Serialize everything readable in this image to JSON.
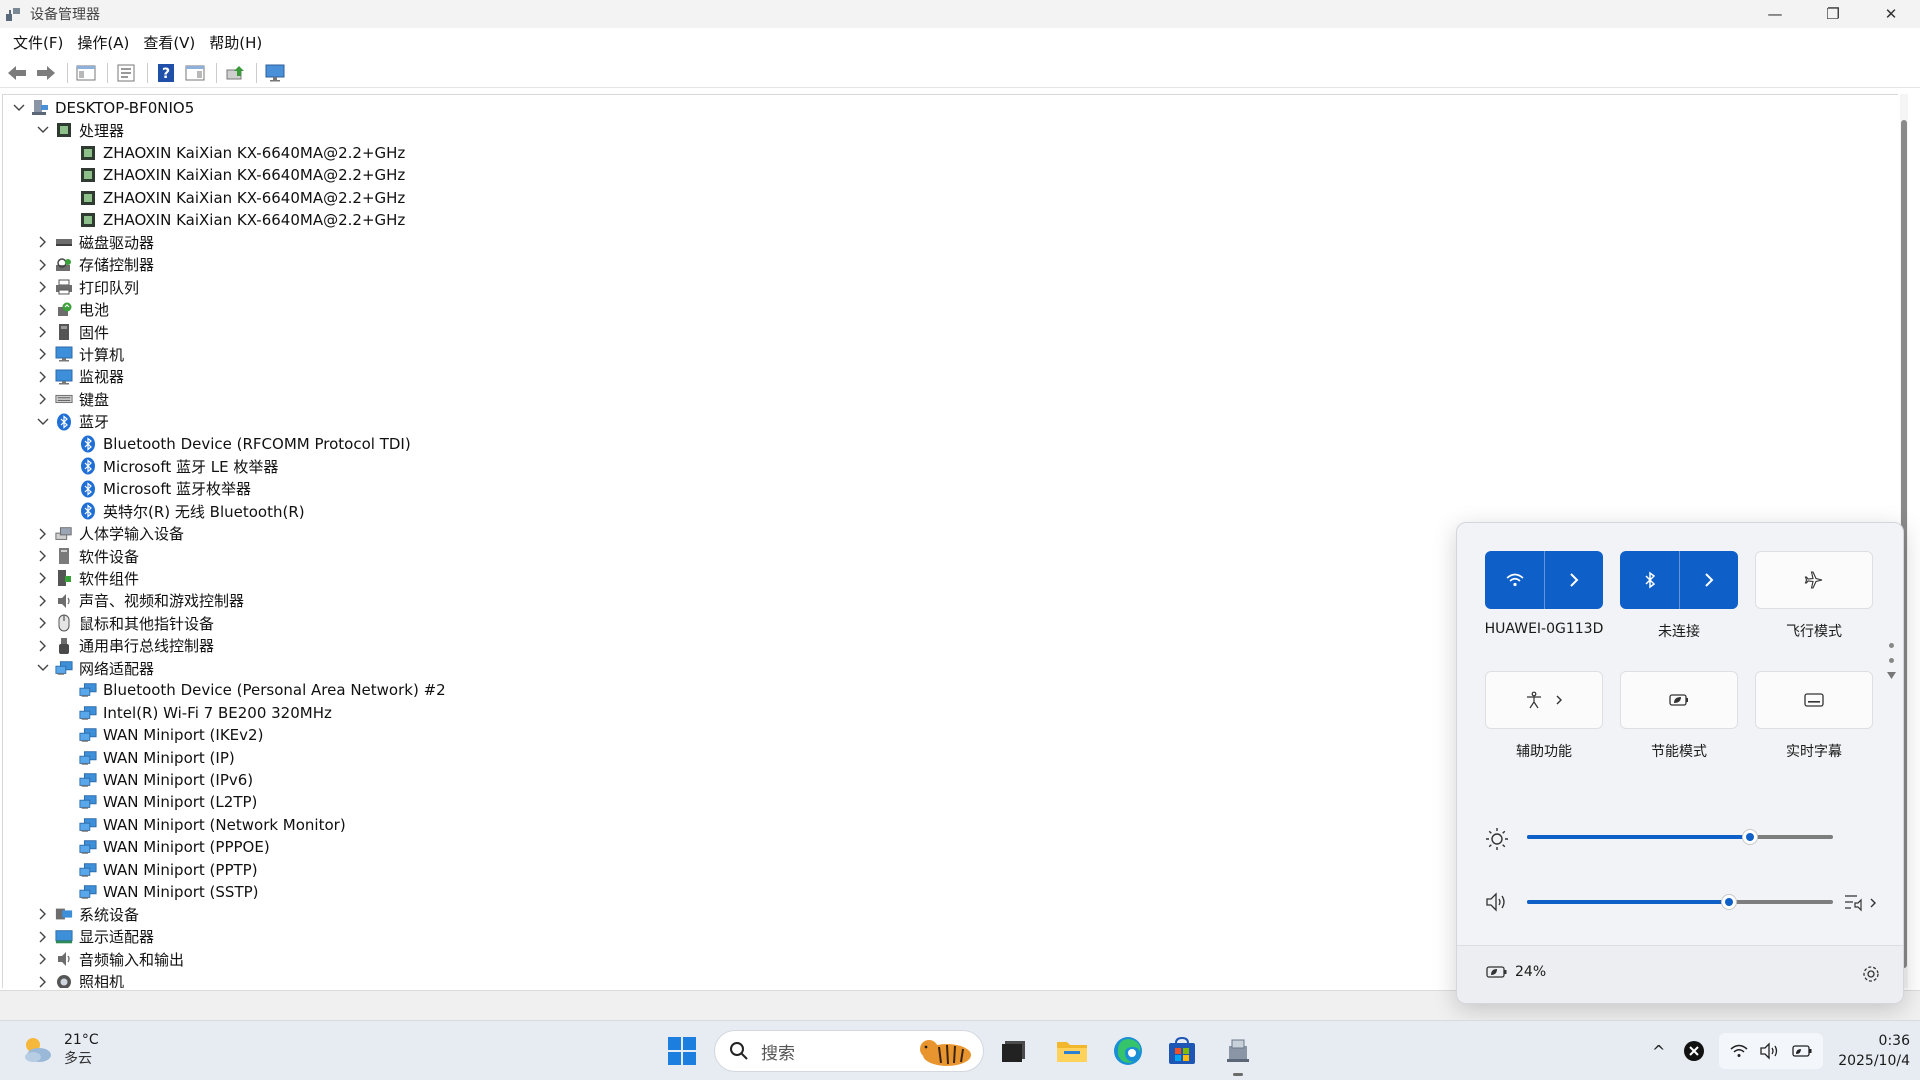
{
  "window": {
    "title": "设备管理器",
    "controls": {
      "minimize": "—",
      "restore": "❐",
      "close": "✕"
    }
  },
  "menu": [
    "文件(F)",
    "操作(A)",
    "查看(V)",
    "帮助(H)"
  ],
  "tree": [
    {
      "level": 0,
      "expander": "v",
      "icon": "computer-icon",
      "label": "DESKTOP-BF0NIO5"
    },
    {
      "level": 1,
      "expander": "v",
      "icon": "processor-icon",
      "label": "处理器"
    },
    {
      "level": 2,
      "expander": "",
      "icon": "processor-icon",
      "label": "ZHAOXIN KaiXian KX-6640MA@2.2+GHz"
    },
    {
      "level": 2,
      "expander": "",
      "icon": "processor-icon",
      "label": "ZHAOXIN KaiXian KX-6640MA@2.2+GHz"
    },
    {
      "level": 2,
      "expander": "",
      "icon": "processor-icon",
      "label": "ZHAOXIN KaiXian KX-6640MA@2.2+GHz"
    },
    {
      "level": 2,
      "expander": "",
      "icon": "processor-icon",
      "label": "ZHAOXIN KaiXian KX-6640MA@2.2+GHz"
    },
    {
      "level": 1,
      "expander": ">",
      "icon": "disk-drive-icon",
      "label": "磁盘驱动器"
    },
    {
      "level": 1,
      "expander": ">",
      "icon": "storage-controller-icon",
      "label": "存储控制器"
    },
    {
      "level": 1,
      "expander": ">",
      "icon": "printer-icon",
      "label": "打印队列"
    },
    {
      "level": 1,
      "expander": ">",
      "icon": "battery-icon",
      "label": "电池"
    },
    {
      "level": 1,
      "expander": ">",
      "icon": "firmware-icon",
      "label": "固件"
    },
    {
      "level": 1,
      "expander": ">",
      "icon": "monitor-icon",
      "label": "计算机"
    },
    {
      "level": 1,
      "expander": ">",
      "icon": "monitor-icon",
      "label": "监视器"
    },
    {
      "level": 1,
      "expander": ">",
      "icon": "keyboard-icon",
      "label": "键盘"
    },
    {
      "level": 1,
      "expander": "v",
      "icon": "bluetooth-icon",
      "label": "蓝牙"
    },
    {
      "level": 2,
      "expander": "",
      "icon": "bluetooth-icon",
      "label": "Bluetooth Device (RFCOMM Protocol TDI)"
    },
    {
      "level": 2,
      "expander": "",
      "icon": "bluetooth-icon",
      "label": "Microsoft 蓝牙 LE 枚举器"
    },
    {
      "level": 2,
      "expander": "",
      "icon": "bluetooth-icon",
      "label": "Microsoft 蓝牙枚举器"
    },
    {
      "level": 2,
      "expander": "",
      "icon": "bluetooth-icon",
      "label": "英特尔(R) 无线 Bluetooth(R)"
    },
    {
      "level": 1,
      "expander": ">",
      "icon": "hid-icon",
      "label": "人体学输入设备"
    },
    {
      "level": 1,
      "expander": ">",
      "icon": "software-device-icon",
      "label": "软件设备"
    },
    {
      "level": 1,
      "expander": ">",
      "icon": "software-component-icon",
      "label": "软件组件"
    },
    {
      "level": 1,
      "expander": ">",
      "icon": "speaker-icon",
      "label": "声音、视频和游戏控制器"
    },
    {
      "level": 1,
      "expander": ">",
      "icon": "mouse-icon",
      "label": "鼠标和其他指针设备"
    },
    {
      "level": 1,
      "expander": ">",
      "icon": "usb-icon",
      "label": "通用串行总线控制器"
    },
    {
      "level": 1,
      "expander": "v",
      "icon": "network-adapter-icon",
      "label": "网络适配器"
    },
    {
      "level": 2,
      "expander": "",
      "icon": "network-adapter-icon",
      "label": "Bluetooth Device (Personal Area Network) #2"
    },
    {
      "level": 2,
      "expander": "",
      "icon": "network-adapter-icon",
      "label": "Intel(R) Wi-Fi 7 BE200 320MHz"
    },
    {
      "level": 2,
      "expander": "",
      "icon": "network-adapter-icon",
      "label": "WAN Miniport (IKEv2)"
    },
    {
      "level": 2,
      "expander": "",
      "icon": "network-adapter-icon",
      "label": "WAN Miniport (IP)"
    },
    {
      "level": 2,
      "expander": "",
      "icon": "network-adapter-icon",
      "label": "WAN Miniport (IPv6)"
    },
    {
      "level": 2,
      "expander": "",
      "icon": "network-adapter-icon",
      "label": "WAN Miniport (L2TP)"
    },
    {
      "level": 2,
      "expander": "",
      "icon": "network-adapter-icon",
      "label": "WAN Miniport (Network Monitor)"
    },
    {
      "level": 2,
      "expander": "",
      "icon": "network-adapter-icon",
      "label": "WAN Miniport (PPPOE)"
    },
    {
      "level": 2,
      "expander": "",
      "icon": "network-adapter-icon",
      "label": "WAN Miniport (PPTP)"
    },
    {
      "level": 2,
      "expander": "",
      "icon": "network-adapter-icon",
      "label": "WAN Miniport (SSTP)"
    },
    {
      "level": 1,
      "expander": ">",
      "icon": "system-device-icon",
      "label": "系统设备"
    },
    {
      "level": 1,
      "expander": ">",
      "icon": "display-adapter-icon",
      "label": "显示适配器"
    },
    {
      "level": 1,
      "expander": ">",
      "icon": "speaker-icon",
      "label": "音频输入和输出"
    },
    {
      "level": 1,
      "expander": ">",
      "icon": "camera-icon",
      "label": "照相机"
    }
  ],
  "quick_settings": {
    "wifi_label": "HUAWEI-0G113D",
    "bluetooth_label": "未连接",
    "airplane_label": "飞行模式",
    "accessibility_label": "辅助功能",
    "energy_saver_label": "节能模式",
    "live_captions_label": "实时字幕",
    "brightness_fraction": 0.73,
    "volume_fraction": 0.66,
    "battery_text": "24%"
  },
  "taskbar": {
    "weather_temp": "21°C",
    "weather_cond": "多云",
    "search_placeholder": "搜索",
    "time": "0:36",
    "date": "2025/10/4",
    "tray_expand": "^"
  },
  "colors": {
    "accent": "#0f5fc9",
    "taskbar_bg": "#e7ecf3",
    "panel_bg": "#f2f3f6"
  }
}
